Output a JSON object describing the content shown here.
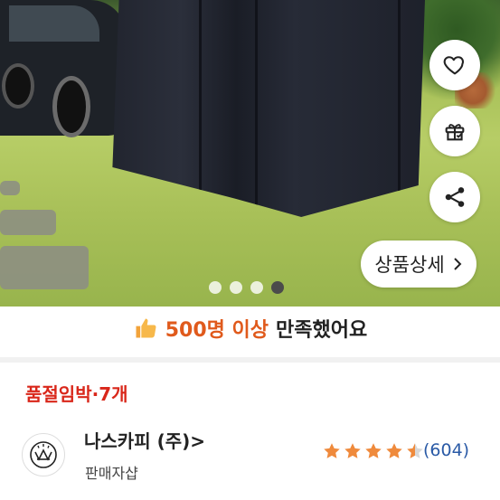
{
  "product": {
    "detail_button": {
      "label": "상품상세",
      "icon": "chevron-right-icon"
    },
    "actions": [
      {
        "icon": "heart-icon"
      },
      {
        "icon": "gift-icon"
      },
      {
        "icon": "share-icon"
      }
    ],
    "image_pager": {
      "total": 4,
      "current": 4
    }
  },
  "satisfaction": {
    "icon": "thumbs-up-icon",
    "highlight": "500명 이상",
    "rest": "만족했어요",
    "accent_color": "#e05a1c"
  },
  "stock_notice": "품절임박·7개",
  "seller": {
    "name": "나스카피 (주)",
    "chevron": ">",
    "type_label": "판매자샵",
    "rating_stars": 4.5,
    "review_count": "(604)"
  },
  "colors": {
    "stock_red": "#d9271a",
    "star": "#ef8a3c",
    "link_blue": "#2a5aa6"
  }
}
